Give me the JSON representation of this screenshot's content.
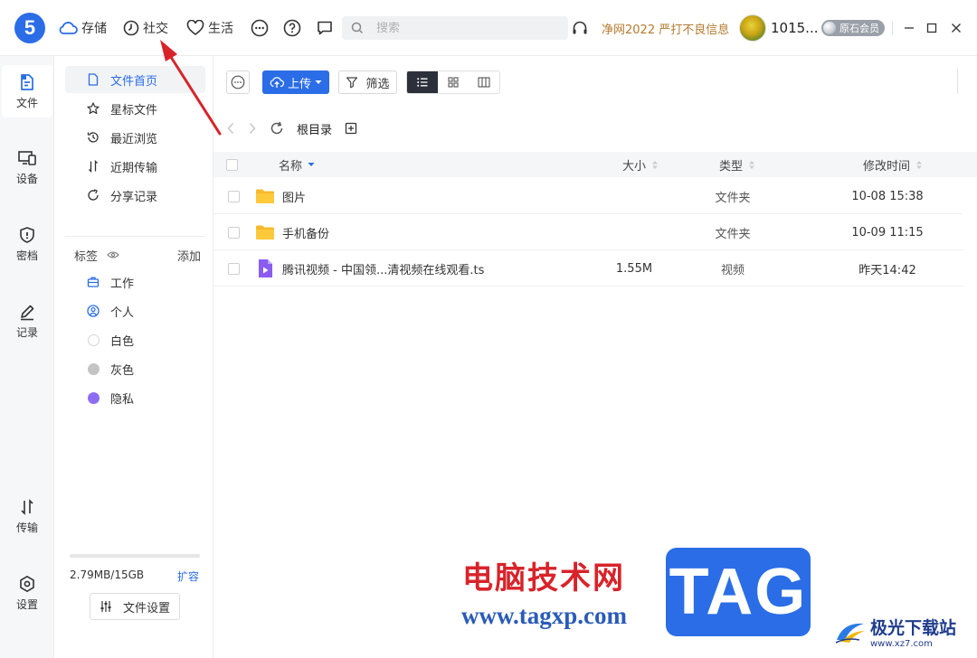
{
  "app": {
    "logo_text": "5"
  },
  "topnav": {
    "items": [
      {
        "label": "存储",
        "icon": "cloud-icon"
      },
      {
        "label": "社交",
        "icon": "clock-icon"
      },
      {
        "label": "生活",
        "icon": "heart-icon"
      }
    ],
    "search_placeholder": "搜索",
    "notice": "净网2022 严打不良信息",
    "username": "1015...",
    "vip_label": "原石会员",
    "window_controls": [
      "minimize",
      "maximize",
      "close"
    ]
  },
  "rail": {
    "items": [
      {
        "label": "文件",
        "icon": "file-icon",
        "active": true
      },
      {
        "label": "设备",
        "icon": "device-icon"
      },
      {
        "label": "密档",
        "icon": "shield-icon"
      },
      {
        "label": "记录",
        "icon": "pen-icon"
      },
      {
        "label": "传输",
        "icon": "transfer-icon"
      },
      {
        "label": "设置",
        "icon": "settings-icon"
      }
    ]
  },
  "sidebar": {
    "nav": [
      {
        "label": "文件首页",
        "icon": "document-icon",
        "active": true
      },
      {
        "label": "星标文件",
        "icon": "star-icon"
      },
      {
        "label": "最近浏览",
        "icon": "history-icon"
      },
      {
        "label": "近期传输",
        "icon": "transfer-icon"
      },
      {
        "label": "分享记录",
        "icon": "share-icon"
      }
    ],
    "tags_title": "标签",
    "tags_add": "添加",
    "tags": [
      {
        "label": "工作",
        "icon": "briefcase-icon"
      },
      {
        "label": "个人",
        "icon": "person-icon"
      },
      {
        "label": "白色",
        "color": "#ffffff"
      },
      {
        "label": "灰色",
        "color": "#c4c4c4"
      },
      {
        "label": "隐私",
        "color": "#8f6df2"
      }
    ],
    "storage_text": "2.79MB/15GB",
    "storage_used_fraction": 0.0002,
    "expand_label": "扩容",
    "file_settings_label": "文件设置"
  },
  "toolbar": {
    "upload_label": "上传",
    "filter_label": "筛选"
  },
  "breadcrumb": {
    "root": "根目录"
  },
  "table": {
    "headers": {
      "name": "名称",
      "size": "大小",
      "type": "类型",
      "modified": "修改时间"
    },
    "rows": [
      {
        "name": "图片",
        "size": "",
        "type": "文件夹",
        "modified": "10-08 15:38",
        "icon": "folder-icon"
      },
      {
        "name": "手机备份",
        "size": "",
        "type": "文件夹",
        "modified": "10-09 11:15",
        "icon": "folder-icon"
      },
      {
        "name": "腾讯视频 - 中国领...清视频在线观看.ts",
        "size": "1.55M",
        "type": "视频",
        "modified": "昨天14:42",
        "icon": "video-file-icon"
      }
    ]
  },
  "watermark": {
    "site_name": "电脑技术网",
    "url": "www.tagxp.com",
    "badge": "TAG",
    "corner_name": "极光下载站",
    "corner_url": "www.xz7.com"
  },
  "colors": {
    "accent": "#2a6de6",
    "notice": "#b47a2e",
    "arrow": "#d8232a"
  }
}
